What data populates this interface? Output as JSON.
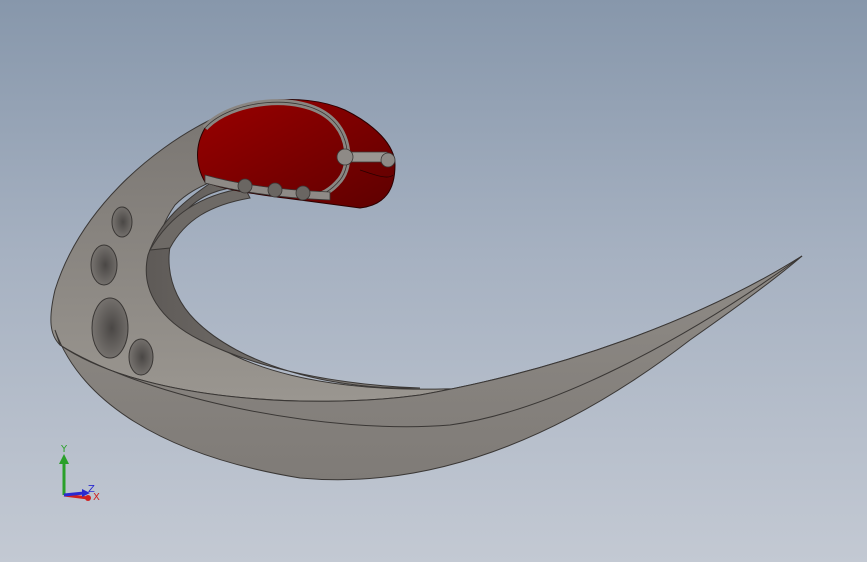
{
  "viewport": {
    "background_top": "#8797ab",
    "background_bottom": "#c3c9d3"
  },
  "model": {
    "body_color": "#8e8a85",
    "grip_color": "#7a0000",
    "hole_count": 4
  },
  "triad": {
    "y_label": "Y",
    "z_label": "Z",
    "x_label": "X",
    "y_color": "#2aa02a",
    "z_color": "#2a2ad0",
    "x_color": "#d02020"
  }
}
